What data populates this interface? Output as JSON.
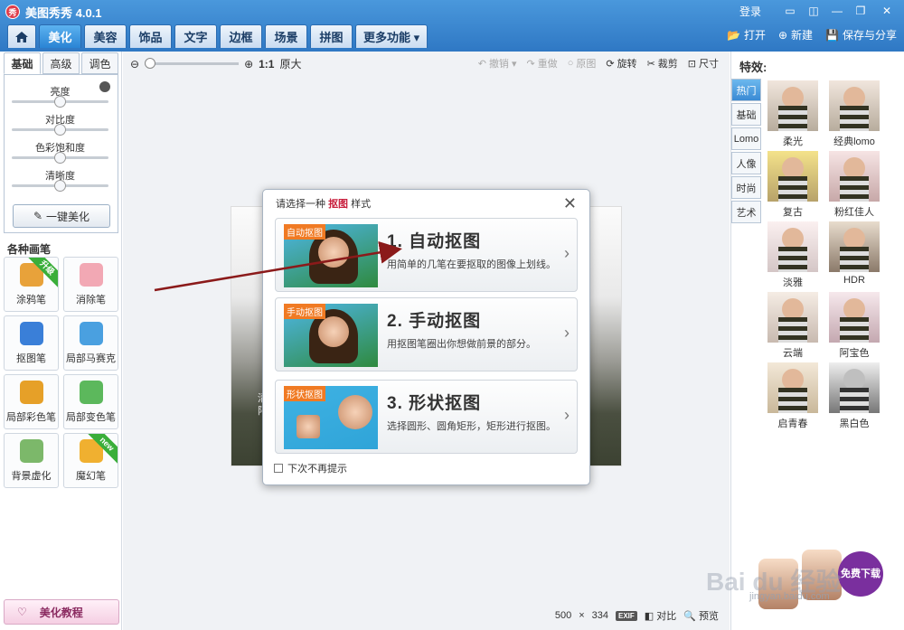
{
  "app": {
    "title": "美图秀秀 4.0.1",
    "logo": "秀",
    "login": "登录"
  },
  "tabs": [
    {
      "label": "美化",
      "active": true
    },
    {
      "label": "美容"
    },
    {
      "label": "饰品"
    },
    {
      "label": "文字"
    },
    {
      "label": "边框"
    },
    {
      "label": "场景"
    },
    {
      "label": "拼图"
    },
    {
      "label": "更多功能 ▾"
    }
  ],
  "top_actions": {
    "open": "打开",
    "new": "新建",
    "save_share": "保存与分享"
  },
  "left_panel": {
    "subtabs": [
      "基础",
      "高级",
      "调色"
    ],
    "sliders": [
      {
        "label": "亮度",
        "value": 0.5
      },
      {
        "label": "对比度",
        "value": 0.5
      },
      {
        "label": "色彩饱和度",
        "value": 0.5
      },
      {
        "label": "清晰度",
        "value": 0.5
      }
    ],
    "onekey_label": "一键美化",
    "brush_title": "各种画笔",
    "brushes": [
      {
        "label": "涂鸦笔",
        "ribbon": "升级",
        "color": "#e8a23a"
      },
      {
        "label": "消除笔",
        "color": "#f2a8b4"
      },
      {
        "label": "抠图笔",
        "color": "#3a7fd8"
      },
      {
        "label": "局部马赛克",
        "color": "#4aa0e0"
      },
      {
        "label": "局部彩色笔",
        "color": "#e6a028"
      },
      {
        "label": "局部变色笔",
        "color": "#5cb85c"
      },
      {
        "label": "背景虚化",
        "color": "#7cb86a"
      },
      {
        "label": "魔幻笔",
        "ribbon": "new",
        "color": "#f0b030"
      }
    ],
    "tutorial_label": "美化教程"
  },
  "canvas": {
    "zoom_original": "1:1",
    "zoom_original_label": "原大",
    "tools": {
      "undo": "撤销",
      "redo": "重做",
      "original": "原图",
      "rotate": "旋转",
      "crop": "裁剪",
      "size": "尺寸"
    },
    "text_lines": [
      "清",
      "阳"
    ],
    "status": {
      "width": "500",
      "times": "×",
      "height": "334",
      "exif": "EXIF",
      "compare": "对比",
      "preview": "预览"
    }
  },
  "dialog": {
    "title_prefix": "请选择一种 ",
    "title_highlight": "抠图",
    "title_suffix": " 样式",
    "options": [
      {
        "tag": "自动抠图",
        "title": "1. 自动抠图",
        "desc": "用简单的几笔在要抠取的图像上划线。"
      },
      {
        "tag": "手动抠图",
        "title": "2. 手动抠图",
        "desc": "用抠图笔圈出你想做前景的部分。"
      },
      {
        "tag": "形状抠图",
        "title": "3. 形状抠图",
        "desc": "选择圆形、圆角矩形，矩形进行抠图。"
      }
    ],
    "dont_show": "下次不再提示"
  },
  "right_panel": {
    "title": "特效:",
    "categories": [
      {
        "label": "热门",
        "active": true
      },
      {
        "label": "基础"
      },
      {
        "label": "Lomo"
      },
      {
        "label": "人像"
      },
      {
        "label": "时尚"
      },
      {
        "label": "艺术"
      }
    ],
    "effects": [
      "柔光",
      "经典lomo",
      "复古",
      "粉红佳人",
      "淡雅",
      "HDR",
      "云端",
      "阿宝色",
      "启青春",
      "黑白色"
    ],
    "ad_label": "免费下载",
    "watermark": "Bai du 经验",
    "watermark_sub": "jingyan.baidu.com"
  },
  "colors": {
    "accent": "#2f78c4",
    "highlight": "#c81e3c",
    "tag": "#f07a23"
  }
}
